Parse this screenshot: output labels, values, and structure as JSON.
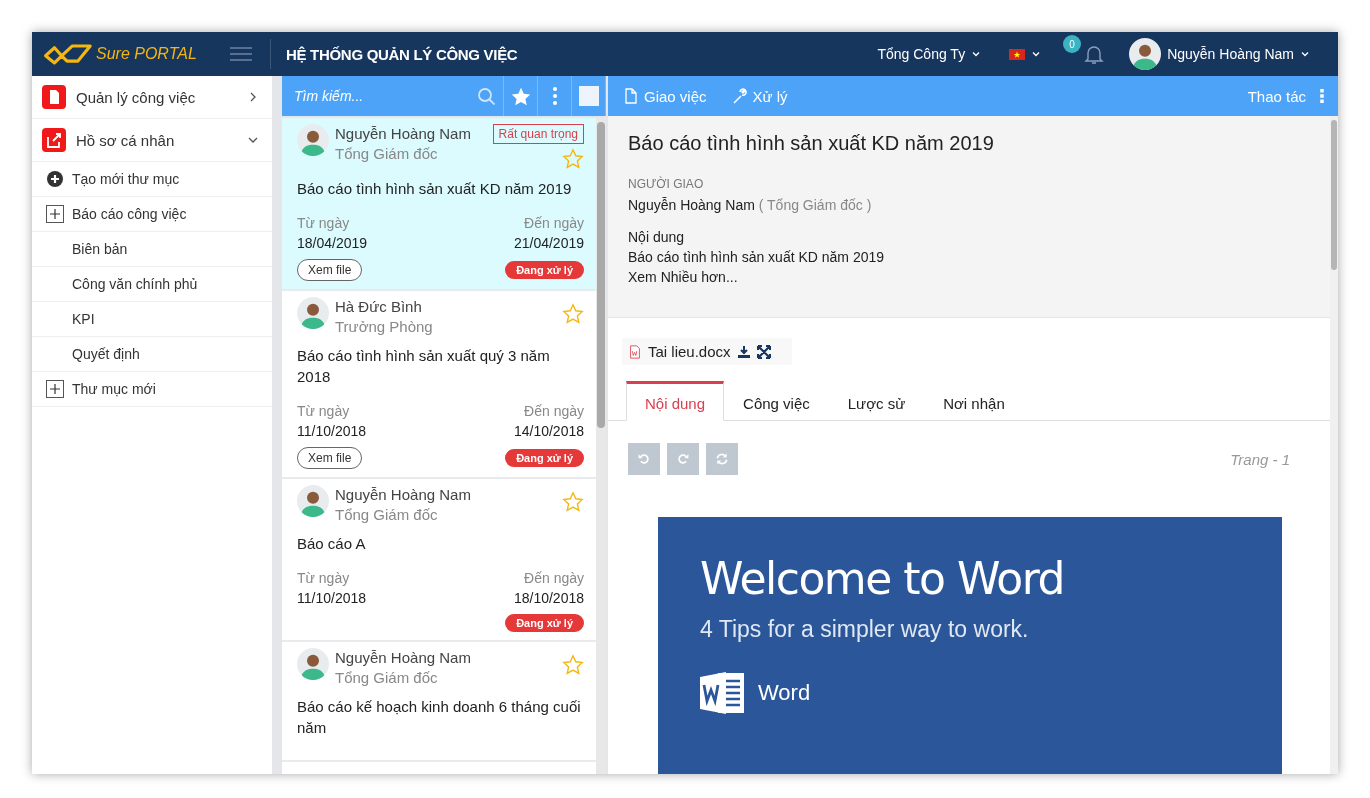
{
  "header": {
    "brand": {
      "first": "Sure",
      "second": "PORTAL"
    },
    "title": "HỆ THỐNG QUẢN LÝ CÔNG VIỆC",
    "company": "Tổng Công Ty",
    "notifications": "0",
    "user": "Nguyễn Hoàng Nam"
  },
  "sidebar": {
    "modules": [
      {
        "label": "Quản lý công việc",
        "expanded": false
      },
      {
        "label": "Hồ sơ cá nhân",
        "expanded": true
      }
    ],
    "create_folder": "Tạo mới thư mục",
    "folders": [
      {
        "label": "Báo cáo công việc",
        "kind": "collapsible"
      },
      {
        "label": "Biên bản",
        "kind": "leaf"
      },
      {
        "label": "Công văn chính phủ",
        "kind": "leaf"
      },
      {
        "label": "KPI",
        "kind": "leaf"
      },
      {
        "label": "Quyết định",
        "kind": "leaf"
      },
      {
        "label": "Thư mục mới",
        "kind": "collapsible"
      }
    ]
  },
  "task_list": {
    "search": {
      "placeholder": "Tìm kiếm..."
    },
    "select_all": {
      "checked": false
    },
    "tasks": [
      {
        "selected": true,
        "name": "Nguyễn Hoàng Nam",
        "role": "Tổng Giám đốc",
        "priority": "Rất quan trọng",
        "starred": false,
        "title": "Báo cáo tình hình sản xuất KD năm 2019",
        "from_label": "Từ ngày",
        "from_date": "18/04/2019",
        "to_label": "Đến ngày",
        "to_date": "21/04/2019",
        "file_button": "Xem file",
        "status": "Đang xử lý"
      },
      {
        "selected": false,
        "name": "Hà Đức Bình",
        "role": "Trưởng Phòng",
        "starred": false,
        "title": "Báo cáo tình hình sản xuất quý 3 năm 2018",
        "from_label": "Từ ngày",
        "from_date": "11/10/2018",
        "to_label": "Đến ngày",
        "to_date": "14/10/2018",
        "file_button": "Xem file",
        "status": "Đang xử lý"
      },
      {
        "selected": false,
        "name": "Nguyễn Hoàng Nam",
        "role": "Tổng Giám đốc",
        "starred": false,
        "title": "Báo cáo A",
        "from_label": "Từ ngày",
        "from_date": "11/10/2018",
        "to_label": "Đến ngày",
        "to_date": "18/10/2018",
        "status": "Đang xử lý"
      },
      {
        "selected": false,
        "name": "Nguyễn Hoàng Nam",
        "role": "Tổng Giám đốc",
        "starred": false,
        "title": "Báo cáo kế hoạch kinh doanh 6 tháng cuối năm"
      }
    ]
  },
  "detail": {
    "actions": [
      "Giao việc",
      "Xử lý"
    ],
    "menu": "Thao tác",
    "title": "Báo cáo tình hình sản xuất KD năm 2019",
    "assigner_label": "NGƯỜI GIAO",
    "assigner_name": "Nguyễn Hoàng Nam",
    "assigner_role": "( Tổng Giám đốc )",
    "content_label": "Nội dung",
    "content": "Báo cáo tình hình sản xuất KD năm 2019",
    "more": "Xem Nhiều hơn...",
    "attachment": "Tai lieu.docx",
    "tabs": [
      {
        "label": "Nội dung",
        "selected": true
      },
      {
        "label": "Công việc",
        "selected": false
      },
      {
        "label": "Lược sử",
        "selected": false
      },
      {
        "label": "Nơi nhận",
        "selected": false
      }
    ],
    "page": "Trang - 1",
    "document": {
      "heading": "Welcome to Word",
      "subtitle": "4 Tips for a simpler way to work.",
      "app": "Word"
    }
  }
}
